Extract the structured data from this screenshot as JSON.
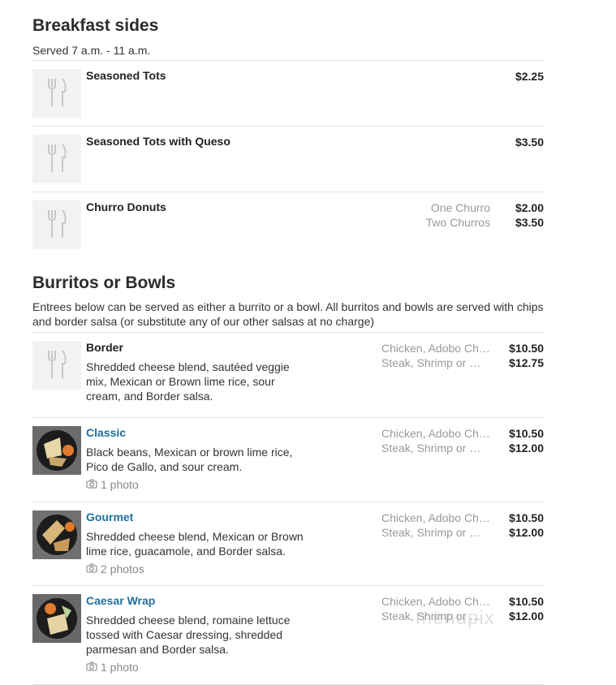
{
  "breakfast": {
    "title": "Breakfast sides",
    "subtitle": "Served 7 a.m. - 11 a.m.",
    "items": [
      {
        "name": "Seasoned Tots",
        "price": "$2.25"
      },
      {
        "name": "Seasoned Tots with Queso",
        "price": "$3.50"
      },
      {
        "name": "Churro Donuts",
        "options": [
          "One Churro",
          "Two Churros"
        ],
        "prices": [
          "$2.00",
          "$3.50"
        ]
      }
    ]
  },
  "burritos": {
    "title": "Burritos or Bowls",
    "subtitle": "Entrees below can be served as either a burrito or a bowl. All burritos and bowls are served with chips and border salsa (or substitute any of our other salsas at no charge)",
    "items": [
      {
        "name": "Border",
        "description": "Shredded cheese blend, sautéed veggie mix, Mexican or Brown lime rice, sour cream, and Border salsa.",
        "options": [
          "Chicken, Adobo Ch…",
          "Steak, Shrimp or …"
        ],
        "prices": [
          "$10.50",
          "$12.75"
        ],
        "photos": ""
      },
      {
        "name": "Classic",
        "description": "Black beans, Mexican or brown lime rice, Pico de Gallo, and sour cream.",
        "options": [
          "Chicken, Adobo Ch…",
          "Steak, Shrimp or …"
        ],
        "prices": [
          "$10.50",
          "$12.00"
        ],
        "photos": "1 photo"
      },
      {
        "name": "Gourmet",
        "description": "Shredded cheese blend, Mexican or Brown lime rice, guacamole, and Border salsa.",
        "options": [
          "Chicken, Adobo Ch…",
          "Steak, Shrimp or …"
        ],
        "prices": [
          "$10.50",
          "$12.00"
        ],
        "photos": "2 photos"
      },
      {
        "name": "Caesar Wrap",
        "description": "Shredded cheese blend, romaine lettuce tossed with Caesar dressing, shredded parmesan and Border salsa.",
        "options": [
          "Chicken, Adobo Ch…",
          "Steak, Shrimp or …"
        ],
        "prices": [
          "$10.50",
          "$12.00"
        ],
        "photos": "1 photo"
      }
    ]
  },
  "watermark": "menupix",
  "colors": {
    "link": "#1f6f9f",
    "muted": "#999999",
    "divider": "#e3e3e3"
  },
  "icons": {
    "placeholder": "fork-knife-icon",
    "camera": "camera-icon"
  }
}
